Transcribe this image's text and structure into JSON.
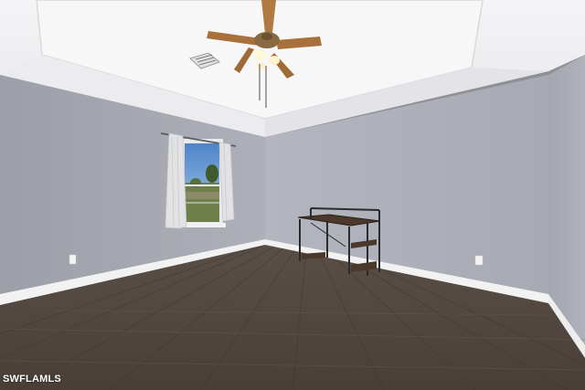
{
  "photo": {
    "watermark": "SWFLAMLS"
  }
}
